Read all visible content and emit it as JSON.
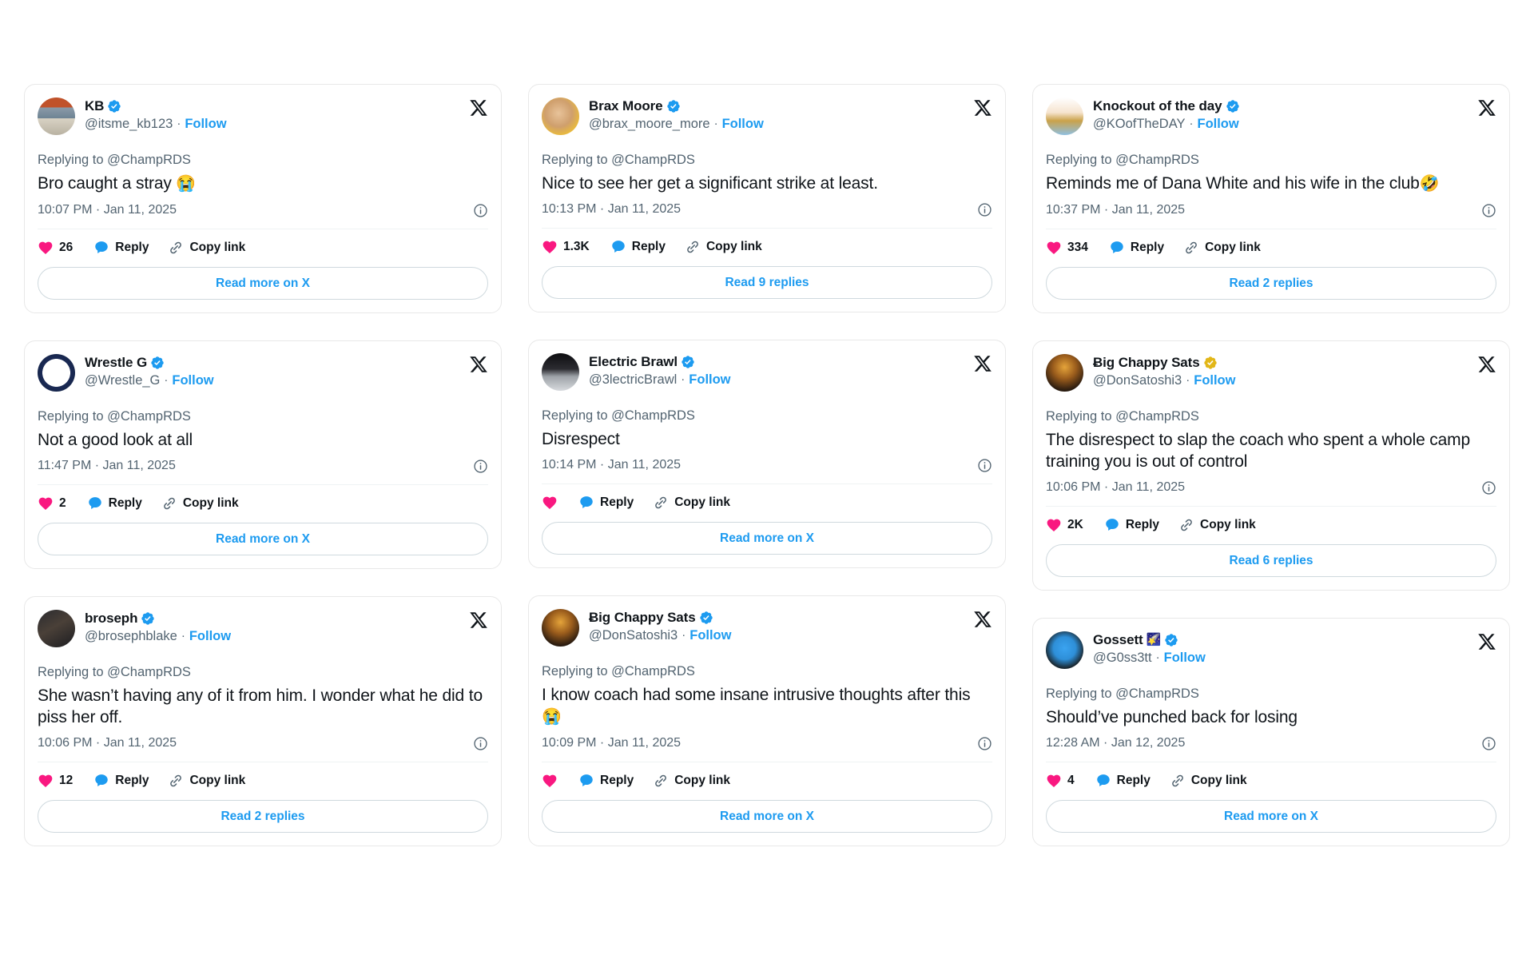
{
  "theme": {
    "page_bg": "#ffffff",
    "card_bg": "#ffffff",
    "card_border": "#e8e8e8",
    "text_primary": "#0f1419",
    "text_secondary": "#536471",
    "link_blue": "#1d9bf0",
    "verified_blue": "#1d9bf0",
    "verified_gold": "#e2b719",
    "heart_pink": "#f91880",
    "reply_blue": "#1d9bf0",
    "link_icon_gray": "#536471",
    "cta_border": "#cfd9de",
    "divider": "#eff3f4"
  },
  "labels": {
    "replying_prefix": "Replying to",
    "reply_action": "Reply",
    "copy_link_action": "Copy link",
    "follow": "Follow",
    "separator": "·"
  },
  "icons": {
    "x_logo": "x-logo-icon",
    "verified": "verified-badge-icon",
    "info": "info-circle-icon",
    "heart": "heart-icon",
    "reply_bubble": "reply-bubble-icon",
    "copy_link": "link-chain-icon",
    "star": "🌟"
  },
  "cards": [
    {
      "id": "kb",
      "column": 1,
      "display_name": "KB",
      "verified": true,
      "verified_color": "blue",
      "star_emoji": "",
      "handle": "@itsme_kb123",
      "follow": "Follow",
      "replying_to": "Replying to @ChampRDS",
      "text": "Bro caught a stray ",
      "emoji": "😭",
      "timestamp": "10:07 PM · Jan 11, 2025",
      "like_count": "26",
      "reply_label": "Reply",
      "copy_label": "Copy link",
      "cta": "Read more on X",
      "avatar_style": "skull"
    },
    {
      "id": "wrestle-g",
      "column": 1,
      "display_name": "Wrestle G",
      "verified": true,
      "verified_color": "blue",
      "star_emoji": "",
      "handle": "@Wrestle_G",
      "follow": "Follow",
      "replying_to": "Replying to @ChampRDS",
      "text": "Not a good look at all",
      "emoji": "",
      "timestamp": "11:47 PM · Jan 11, 2025",
      "like_count": "2",
      "reply_label": "Reply",
      "copy_label": "Copy link",
      "cta": "Read more on X",
      "avatar_style": "wrestleg"
    },
    {
      "id": "broseph",
      "column": 1,
      "display_name": "broseph",
      "verified": true,
      "verified_color": "blue",
      "star_emoji": "",
      "handle": "@brosephblake",
      "follow": "Follow",
      "replying_to": "Replying to @ChampRDS",
      "text": "She wasn’t having any of it from him. I wonder what he did to piss her off.",
      "emoji": "",
      "timestamp": "10:06 PM · Jan 11, 2025",
      "like_count": "12",
      "reply_label": "Reply",
      "copy_label": "Copy link",
      "cta": "Read 2 replies",
      "avatar_style": "broseph"
    },
    {
      "id": "brax-moore",
      "column": 2,
      "display_name": "Brax Moore",
      "verified": true,
      "verified_color": "blue",
      "star_emoji": "",
      "handle": "@brax_moore_more",
      "follow": "Follow",
      "replying_to": "Replying to @ChampRDS",
      "text": "Nice to see her get a significant strike at least.",
      "emoji": "",
      "timestamp": "10:13 PM · Jan 11, 2025",
      "like_count": "1.3K",
      "reply_label": "Reply",
      "copy_label": "Copy link",
      "cta": "Read 9 replies",
      "avatar_style": "brax"
    },
    {
      "id": "electric-brawl",
      "column": 2,
      "display_name": "Electric Brawl",
      "verified": true,
      "verified_color": "blue",
      "star_emoji": "",
      "handle": "@3lectricBrawl",
      "follow": "Follow",
      "replying_to": "Replying to @ChampRDS",
      "text": "Disrespect",
      "emoji": "",
      "timestamp": "10:14 PM · Jan 11, 2025",
      "like_count": "",
      "reply_label": "Reply",
      "copy_label": "Copy link",
      "cta": "Read more on X",
      "avatar_style": "electric"
    },
    {
      "id": "big-chappy-sats-2",
      "column": 2,
      "display_name": "Ƀig Chappy Sats",
      "verified": true,
      "verified_color": "blue",
      "star_emoji": "",
      "handle": "@DonSatoshi3",
      "follow": "Follow",
      "replying_to": "Replying to @ChampRDS",
      "text": "I know coach had some insane intrusive thoughts after this ",
      "emoji": "😭",
      "timestamp": "10:09 PM · Jan 11, 2025",
      "like_count": "",
      "reply_label": "Reply",
      "copy_label": "Copy link",
      "cta": "Read more on X",
      "avatar_style": "chappy"
    },
    {
      "id": "knockout-of-the-day",
      "column": 3,
      "display_name": "Knockout of the day",
      "verified": true,
      "verified_color": "blue",
      "star_emoji": "",
      "handle": "@KOofTheDAY",
      "follow": "Follow",
      "replying_to": "Replying to @ChampRDS",
      "text": "Reminds me of Dana White and his wife in the club",
      "emoji": "🤣",
      "timestamp": "10:37 PM · Jan 11, 2025",
      "like_count": "334",
      "reply_label": "Reply",
      "copy_label": "Copy link",
      "cta": "Read 2 replies",
      "avatar_style": "knockout"
    },
    {
      "id": "big-chappy-sats-1",
      "column": 3,
      "display_name": "Ƀig Chappy Sats",
      "verified": true,
      "verified_color": "gold",
      "star_emoji": "",
      "handle": "@DonSatoshi3",
      "follow": "Follow",
      "replying_to": "Replying to @ChampRDS",
      "text": "The disrespect to slap the coach who spent a whole camp training you is out of control",
      "emoji": "",
      "timestamp": "10:06 PM · Jan 11, 2025",
      "like_count": "2K",
      "reply_label": "Reply",
      "copy_label": "Copy link",
      "cta": "Read 6 replies",
      "avatar_style": "chappy"
    },
    {
      "id": "gossett",
      "column": 3,
      "display_name": "Gossett",
      "verified": true,
      "verified_color": "blue",
      "star_emoji": "🌠",
      "handle": "@G0ss3tt",
      "follow": "Follow",
      "replying_to": "Replying to @ChampRDS",
      "text": "Should’ve punched back for losing",
      "emoji": "",
      "timestamp": "12:28 AM · Jan 12, 2025",
      "like_count": "4",
      "reply_label": "Reply",
      "copy_label": "Copy link",
      "cta": "Read more on X",
      "avatar_style": "gossett"
    }
  ]
}
